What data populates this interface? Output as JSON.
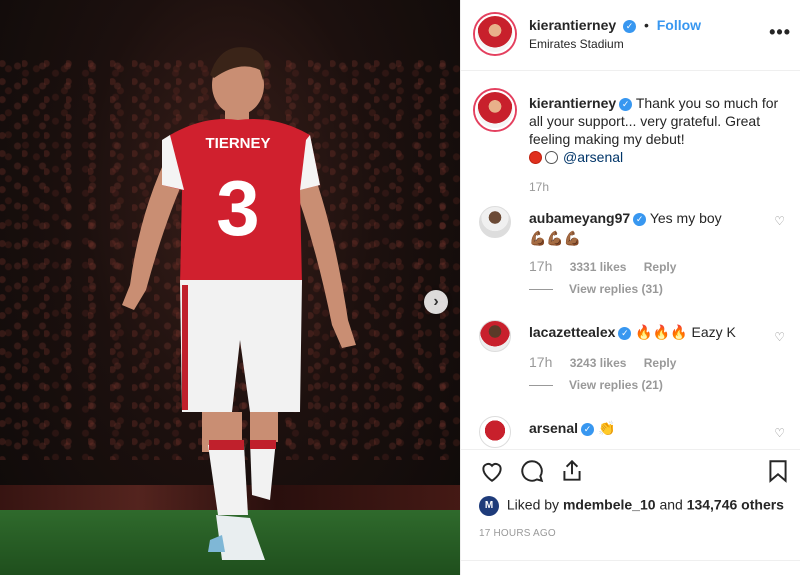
{
  "post": {
    "player_shirt_name": "TIERNEY",
    "player_shirt_number": "3"
  },
  "header": {
    "username": "kierantierney",
    "verified_glyph": "✓",
    "separator": "•",
    "follow_label": "Follow",
    "location": "Emirates Stadium",
    "more_glyph": "•••"
  },
  "caption": {
    "username": "kierantierney",
    "text": "Thank you so much for all your support... very grateful. Great feeling making my debut!",
    "mention": "@arsenal",
    "time": "17h"
  },
  "comments": [
    {
      "username": "aubameyang97",
      "text": "Yes my boy",
      "emoji": "💪🏾💪🏾💪🏾",
      "time": "17h",
      "likes": "3331 likes",
      "reply_label": "Reply",
      "view_replies": "View replies (31)"
    },
    {
      "username": "lacazettealex",
      "text": "🔥🔥🔥 Eazy K",
      "time": "17h",
      "likes": "3243 likes",
      "reply_label": "Reply",
      "view_replies": "View replies (21)"
    },
    {
      "username": "arsenal",
      "text": "👏"
    }
  ],
  "likes": {
    "avatar_letter": "M",
    "prefix": "Liked by",
    "liker": "mdembele_10",
    "connector": "and",
    "others": "134,746 others"
  },
  "timestamp": "17 HOURS AGO",
  "colors": {
    "link_blue": "#3897f0",
    "mention_blue": "#003569",
    "meta_gray": "#999999"
  },
  "icons": {
    "heart": "heart-icon",
    "comment": "comment-bubble-icon",
    "share": "share-icon",
    "save": "bookmark-icon",
    "next": "chevron-right-icon",
    "more": "more-options-icon"
  }
}
